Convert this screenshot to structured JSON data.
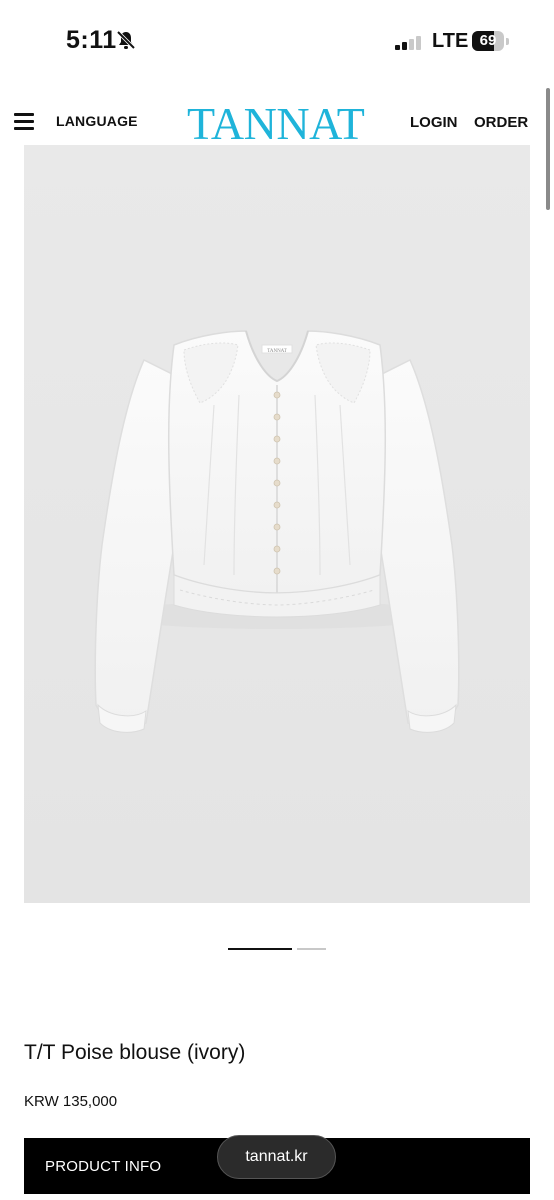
{
  "status_bar": {
    "time": "5:11",
    "network": "LTE",
    "battery": "69",
    "battery_level": 0.69,
    "icons": [
      "bell-muted-icon",
      "signal-icon",
      "battery-icon"
    ]
  },
  "header": {
    "language_label": "LANGUAGE",
    "logo_text": "TANNAT",
    "login_label": "LOGIN",
    "order_label": "ORDER",
    "brand_color": "#1fb4da"
  },
  "product": {
    "image_label": "TANNAT",
    "name": "T/T Poise blouse (ivory)",
    "price": "KRW 135,000",
    "carousel": {
      "count": 2,
      "active": 1
    }
  },
  "info_bar": {
    "label": "PRODUCT INFO"
  },
  "browser": {
    "url": "tannat.kr"
  }
}
